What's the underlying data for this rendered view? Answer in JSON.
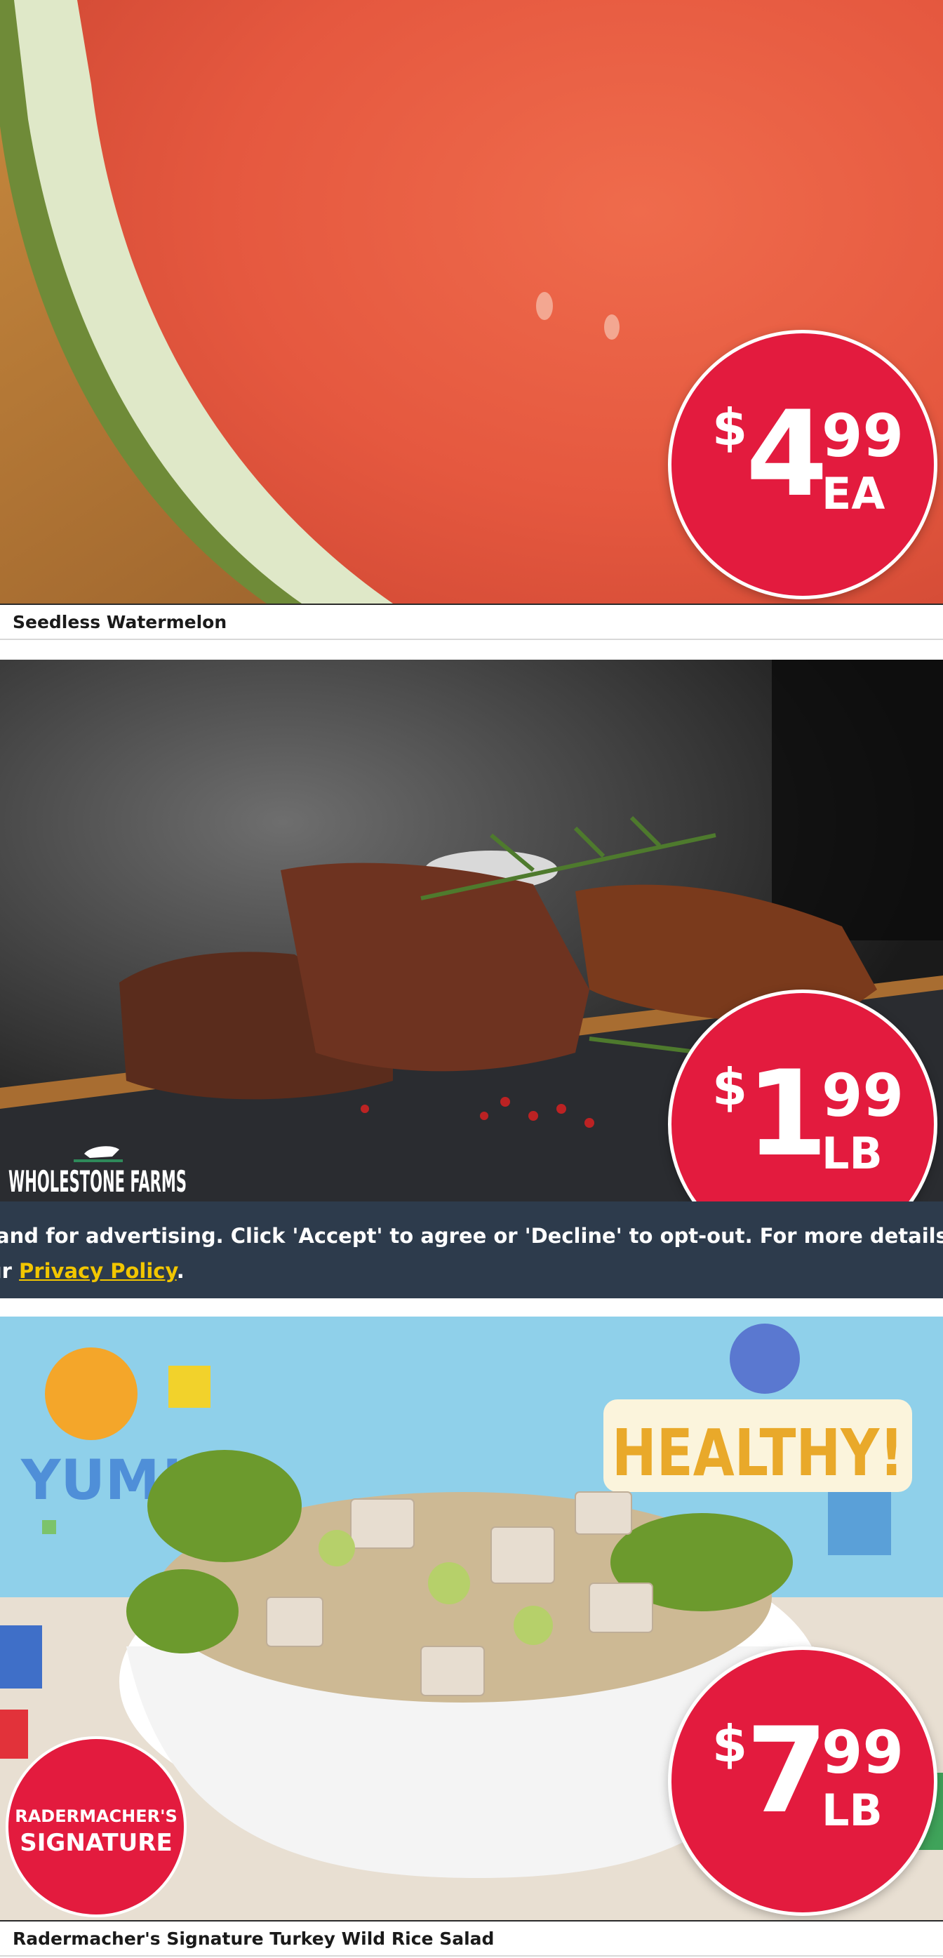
{
  "products": [
    {
      "name": "Seedless Watermelon",
      "price": {
        "currency": "$",
        "whole": "4",
        "cents": "99",
        "unit": "EA"
      }
    },
    {
      "name": "",
      "price": {
        "currency": "$",
        "whole": "1",
        "cents": "99",
        "unit": "LB"
      },
      "brand_logo": "WHOLESTONE FARMS"
    },
    {
      "name": "Radermacher's Signature Turkey Wild Rice Salad",
      "price": {
        "currency": "$",
        "whole": "7",
        "cents": "99",
        "unit": "LB"
      },
      "brand_badge": {
        "line1": "RADERMACHER'S",
        "line2": "SIGNATURE"
      },
      "background_words": [
        "YUM!",
        "HEALTHY!"
      ]
    }
  ],
  "consent_banner": {
    "line1": "and for advertising. Click 'Accept' to agree or 'Decline' to opt-out. For more details or to",
    "line2_prefix": "ur ",
    "privacy_link": "Privacy Policy",
    "line2_suffix": "."
  },
  "colors": {
    "badge_red": "#e31b3e",
    "banner_bg": "#2d3b4c",
    "link_yellow": "#f2c600"
  }
}
